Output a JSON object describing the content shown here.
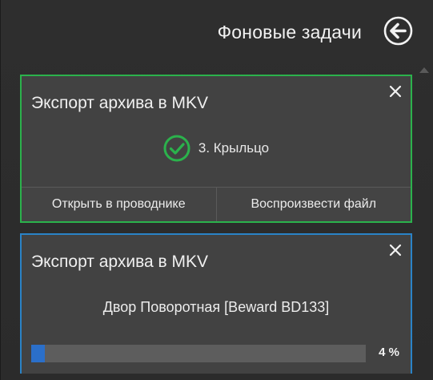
{
  "header": {
    "title": "Фоновые задачи",
    "back_icon": "arrow-left-circle-icon"
  },
  "tasks": [
    {
      "title": "Экспорт архива в MKV",
      "status": "completed",
      "status_icon": "check-circle-icon",
      "status_color": "#2bb24c",
      "camera": "3. Крыльцо",
      "close_icon": "close-icon",
      "actions": {
        "open_in_explorer": "Открыть в проводнике",
        "play_file": "Воспроизвести файл"
      }
    },
    {
      "title": "Экспорт архива в MKV",
      "status": "in-progress",
      "border_color": "#2a83c7",
      "camera": "Двор Поворотная [Beward BD133]",
      "close_icon": "close-icon",
      "progress": 0.04,
      "progress_label": "4 %"
    }
  ]
}
